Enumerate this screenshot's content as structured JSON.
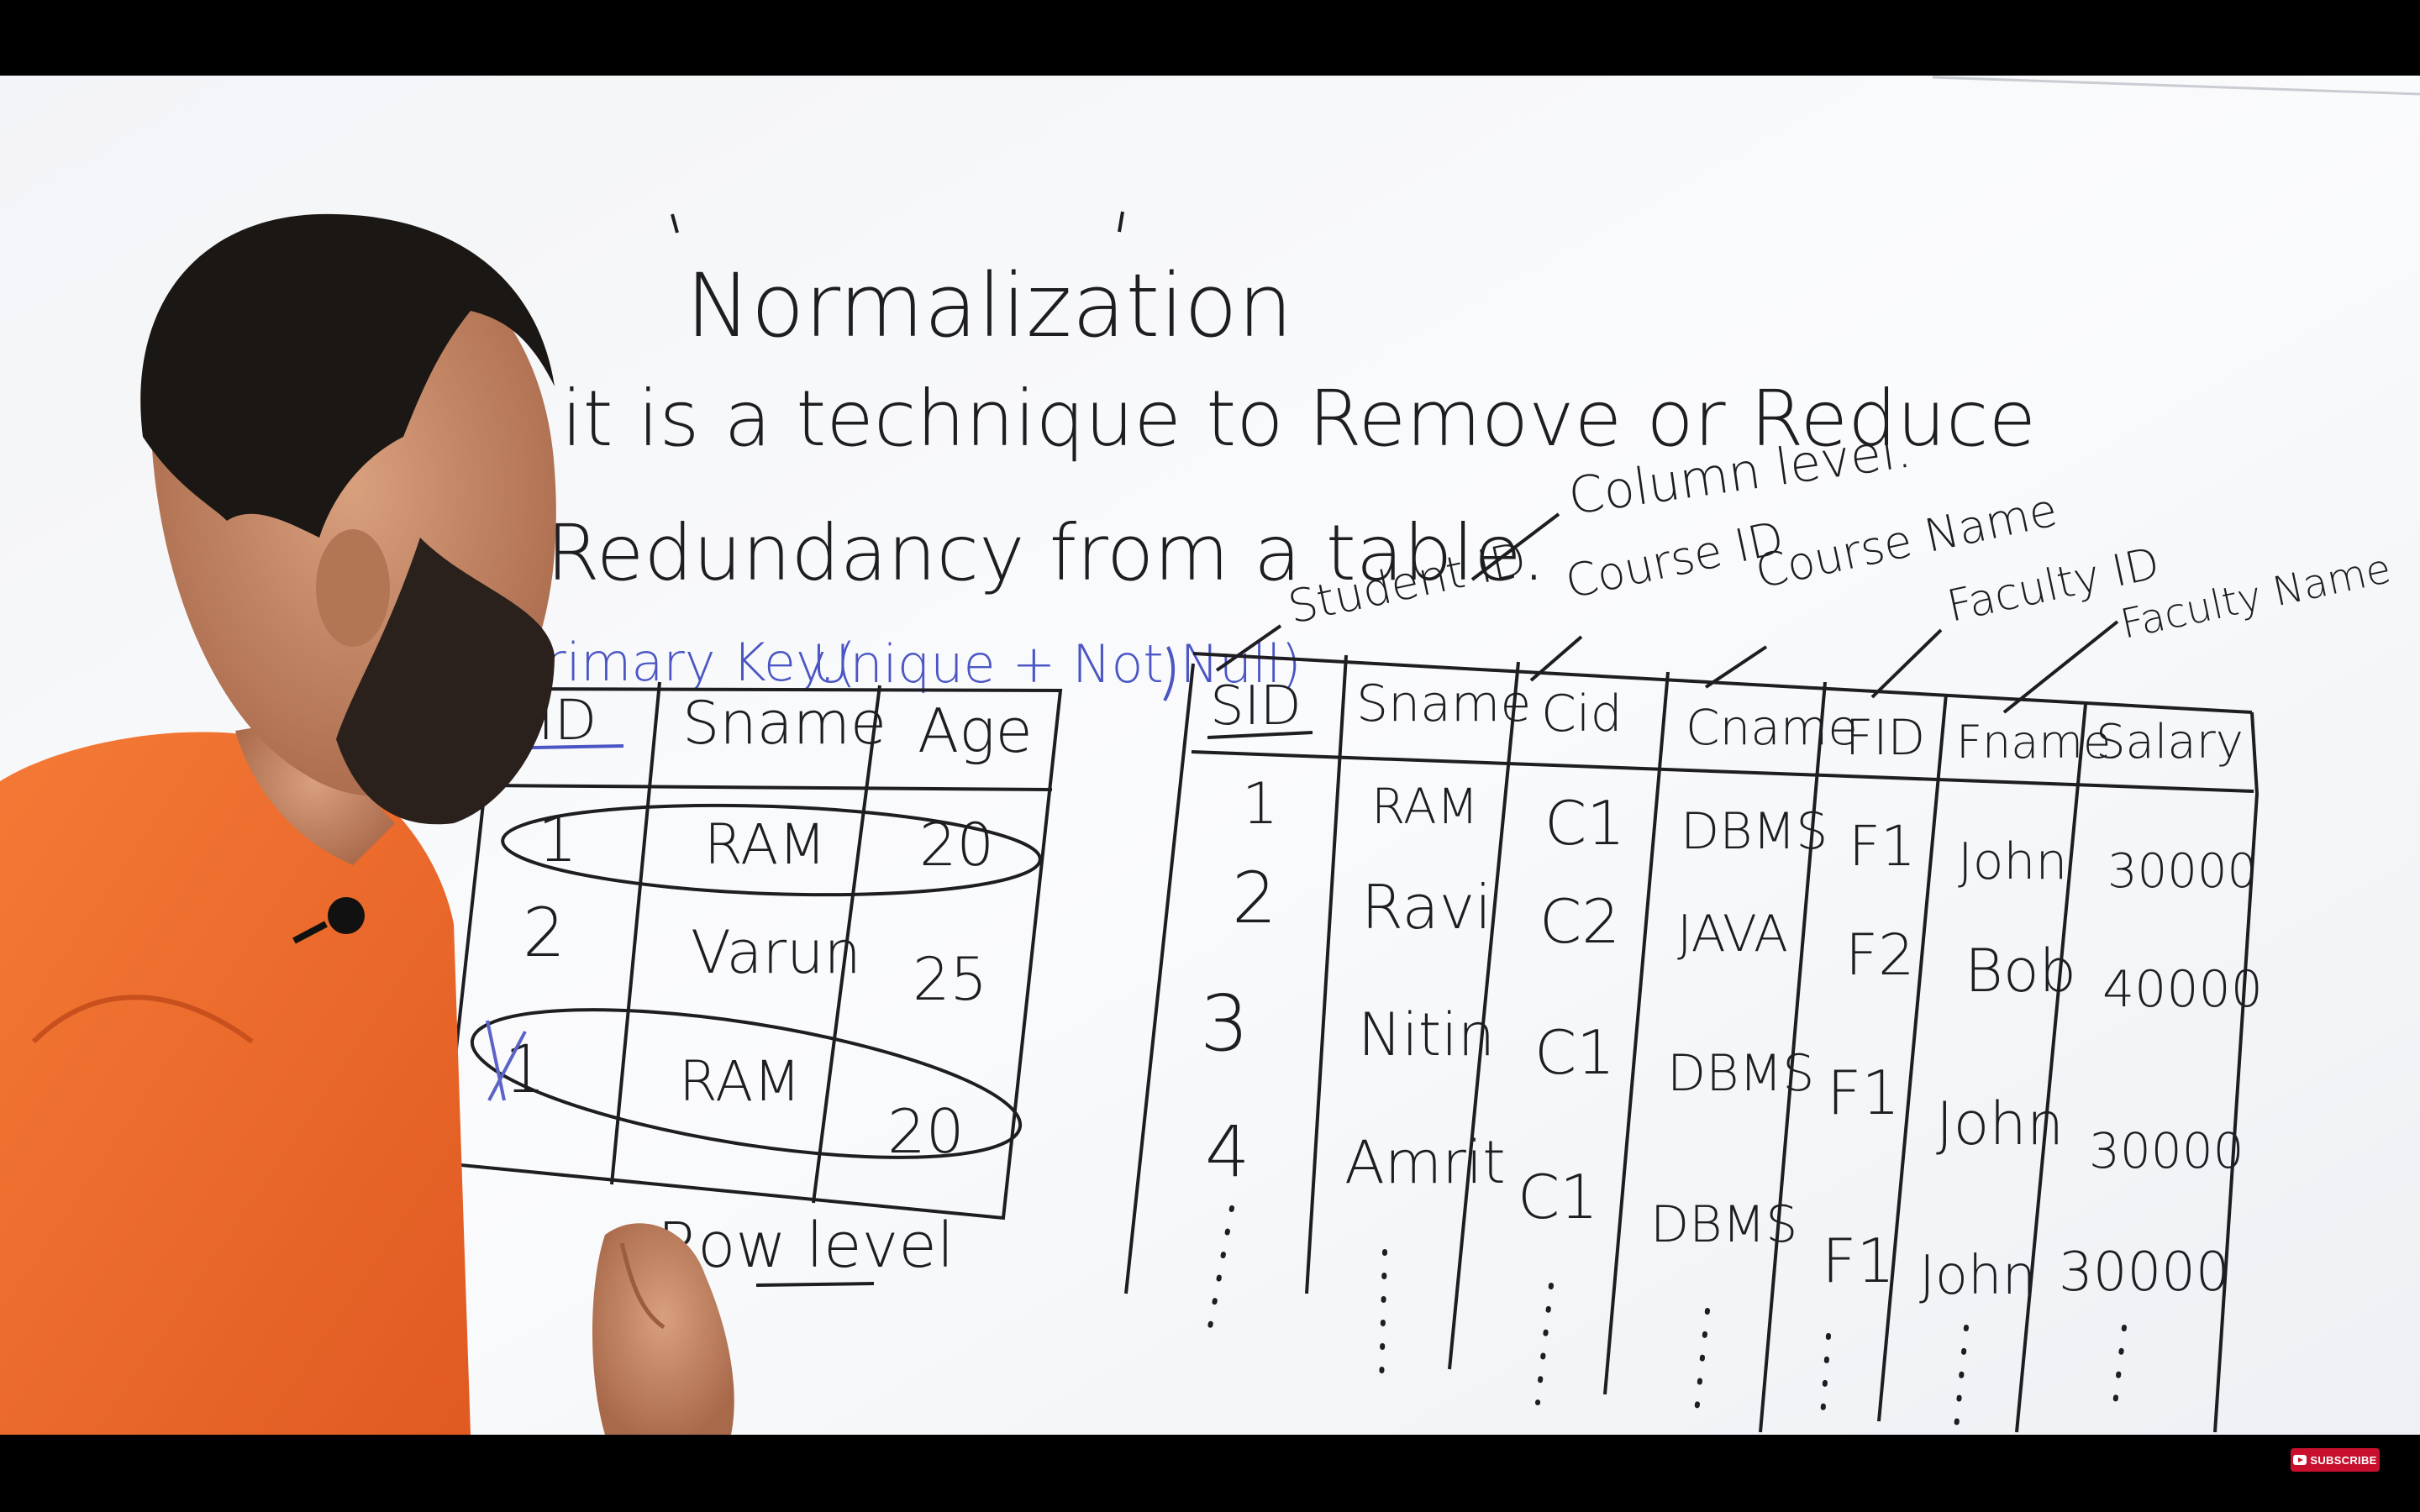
{
  "whiteboard": {
    "title": "Normalization",
    "line1": "it is a technique to Remove or Reduce",
    "line2": "Redundancy from a table.",
    "primary_key_label": "Primary Key.(",
    "primary_key_note": "Unique + Not Null)",
    "row_level_label": "Row level",
    "column_level_label": "Column level.",
    "left_table": {
      "headers": [
        "ID",
        "Sname",
        "Age"
      ],
      "rows": [
        [
          "1",
          "RAM",
          "20"
        ],
        [
          "2",
          "Varun",
          "25"
        ],
        [
          "1",
          "RAM",
          "20"
        ]
      ]
    },
    "right_table": {
      "annotations": [
        "Student ID",
        "Course ID",
        "Course Name",
        "Faculty ID",
        "Faculty Name"
      ],
      "headers": [
        "SID",
        "Sname",
        "Cid",
        "Cname",
        "FID",
        "Fname",
        "Salary"
      ],
      "rows": [
        [
          "1",
          "RAM",
          "C1",
          "DBMS",
          "F1",
          "John",
          "30000"
        ],
        [
          "2",
          "Ravi",
          "C2",
          "JAVA",
          "F2",
          "Bob",
          "40000"
        ],
        [
          "3",
          "Nitin",
          "C1",
          "DBMS",
          "F1",
          "John",
          "30000"
        ],
        [
          "4",
          "Amrit",
          "C1",
          "DBMS",
          "F1",
          "John",
          "30000"
        ]
      ]
    }
  },
  "overlay": {
    "subscribe_label": "SUBSCRIBE"
  },
  "colors": {
    "board": "#f6f7f9",
    "marker": "#1d1d22",
    "blue_marker": "#4b56c4",
    "shirt": "#f06a2c",
    "hair": "#1b1714"
  }
}
